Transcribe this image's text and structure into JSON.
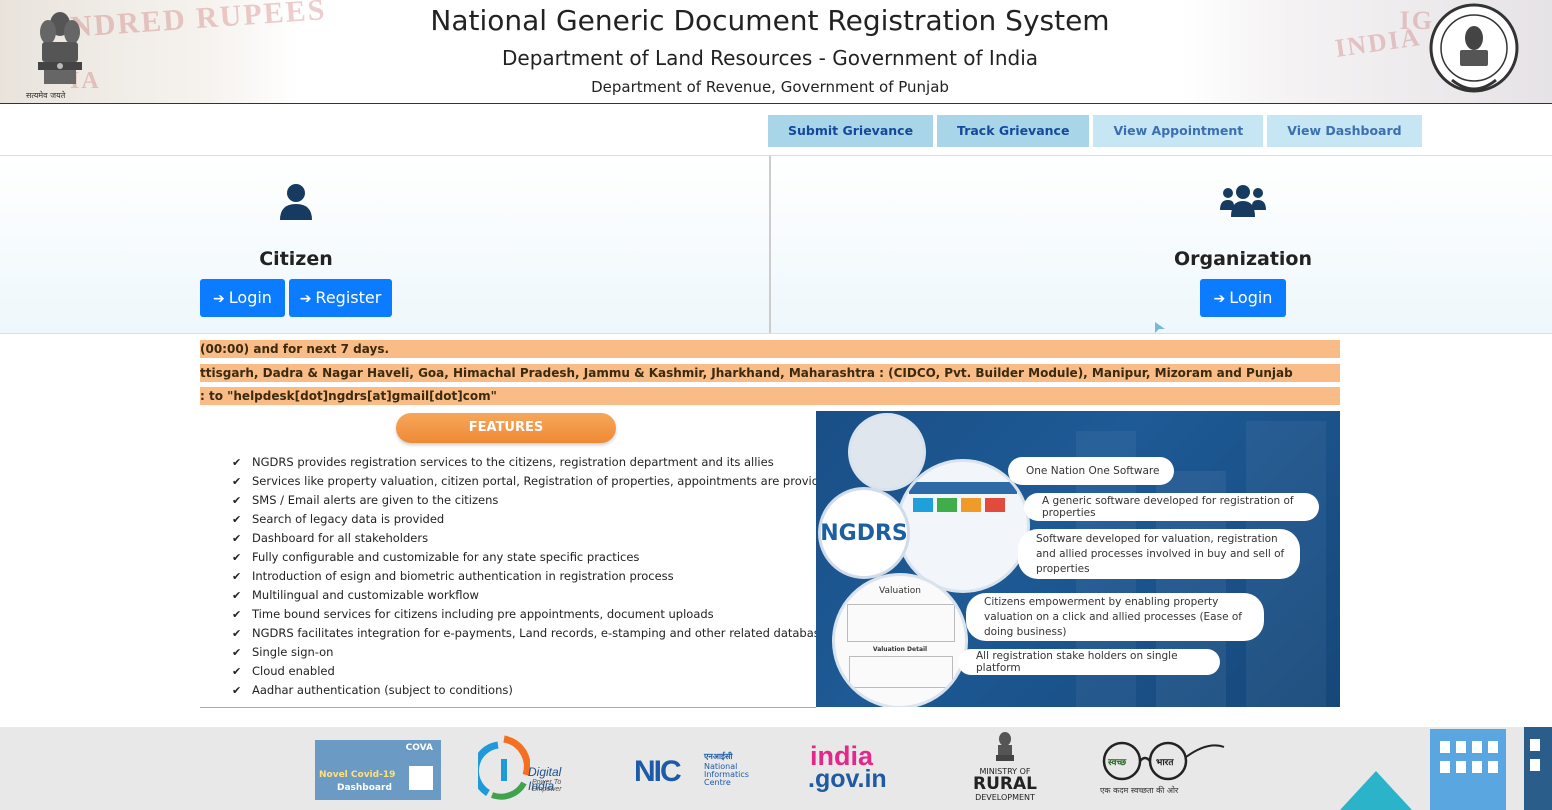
{
  "header": {
    "title": "National Generic Document Registration System",
    "subtitle": "Department of Land Resources - Government of India",
    "subtitle2": "Department of Revenue, Government of Punjab",
    "emblem_caption": "सत्यमेव जयते",
    "bg_left_text": "NDRED RUPEES",
    "bg_left_text2": "IA",
    "bg_right_text": "INDIA",
    "bg_right_text2": "IG"
  },
  "nav": {
    "tabs": [
      {
        "label": "Submit Grievance"
      },
      {
        "label": "Track Grievance"
      },
      {
        "label": "View Appointment"
      },
      {
        "label": "View Dashboard"
      }
    ]
  },
  "citizen": {
    "title": "Citizen",
    "login_label": "Login",
    "register_label": "Register"
  },
  "organization": {
    "title": "Organization",
    "login_label": "Login"
  },
  "tickers": [
    "(00:00) and for next 7 days.",
    "ttisgarh, Dadra & Nagar Haveli, Goa, Himachal Pradesh, Jammu & Kashmir, Jharkhand, Maharashtra : (CIDCO, Pvt. Builder Module), Manipur, Mizoram and Punjab",
    ": to \"helpdesk[dot]ngdrs[at]gmail[dot]com\""
  ],
  "features": {
    "heading": "FEATURES",
    "items": [
      "NGDRS provides registration services to the citizens, registration department and its allies",
      "Services like property valuation, citizen portal, Registration of properties, appointments are provided",
      "SMS / Email alerts are given to the citizens",
      "Search of legacy data is provided",
      "Dashboard for all stakeholders",
      "Fully configurable and customizable for any state specific practices",
      "Introduction of esign and biometric authentication in registration process",
      "Multilingual and customizable workflow",
      "Time bound services for citizens including pre appointments, document uploads",
      "NGDRS facilitates integration for e-payments, Land records, e-stamping and other related databases",
      "Single sign-on",
      "Cloud enabled",
      "Aadhar authentication (subject to conditions)"
    ]
  },
  "promo": {
    "logo_text": "NGDRS",
    "valuation_label": "Valuation",
    "valuation_detail": "Valuation Detail",
    "pills": [
      "One Nation One Software",
      "A generic software developed for  registration of properties",
      "Software developed for valuation, registration and allied processes involved in  buy and sell of properties",
      "Citizens empowerment  by enabling property valuation on a click and allied processes (Ease of doing business)",
      "All registration stake holders on single platform"
    ]
  },
  "footer": {
    "cova": {
      "line1": "Novel Covid-19",
      "line2": "Dashboard",
      "brand": "COVA"
    },
    "digital_india": {
      "name": "Digital India",
      "tagline": "Power To Empower"
    },
    "nic": {
      "hindi": "एनआईसी",
      "line1": "National",
      "line2": "Informatics",
      "line3": "Centre"
    },
    "india_gov": {
      "line1": "india",
      "line2": ".gov.in"
    },
    "rural": {
      "line1": "MINISTRY OF",
      "line2": "RURAL",
      "line3": "DEVELOPMENT"
    },
    "swachh": {
      "word1": "स्वच्छ",
      "word2": "भारत",
      "tagline": "एक कदम स्वच्छता की ओर"
    }
  },
  "colors": {
    "primary_button": "#0b7bff",
    "tab_bg": "#a9d5e8",
    "ticker_bg": "#f9bc86",
    "promo_bg": "#1e5a96",
    "features_pill": "#ee8a36"
  }
}
